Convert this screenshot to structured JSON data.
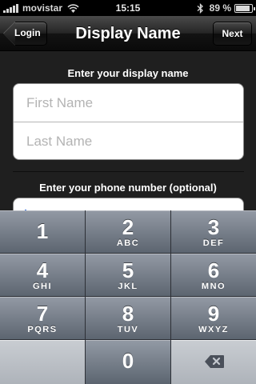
{
  "status_bar": {
    "carrier": "movistar",
    "time": "15:15",
    "battery_percent": "89 %",
    "battery_level": 0.89,
    "icons": [
      "signal-bars-icon",
      "wifi-icon",
      "bluetooth-icon",
      "battery-icon"
    ]
  },
  "nav": {
    "back_label": "Login",
    "title": "Display Name",
    "next_label": "Next"
  },
  "form": {
    "name_section_label": "Enter your display name",
    "first_name_placeholder": "First Name",
    "first_name_value": "",
    "last_name_placeholder": "Last Name",
    "last_name_value": "",
    "phone_section_label": "Enter your phone number (optional)",
    "phone_value": ""
  },
  "keypad": {
    "keys": [
      {
        "num": "1",
        "letters": ""
      },
      {
        "num": "2",
        "letters": "ABC"
      },
      {
        "num": "3",
        "letters": "DEF"
      },
      {
        "num": "4",
        "letters": "GHI"
      },
      {
        "num": "5",
        "letters": "JKL"
      },
      {
        "num": "6",
        "letters": "MNO"
      },
      {
        "num": "7",
        "letters": "PQRS"
      },
      {
        "num": "8",
        "letters": "TUV"
      },
      {
        "num": "9",
        "letters": "WXYZ"
      },
      {
        "num": "0",
        "letters": ""
      }
    ],
    "delete_icon": "delete-backspace-icon"
  },
  "colors": {
    "navbar": "#1a1a1a",
    "background": "#1f1f1f",
    "key": "#6f7782",
    "key_light": "#bcc0c6",
    "cursor": "#3a6fd8"
  }
}
